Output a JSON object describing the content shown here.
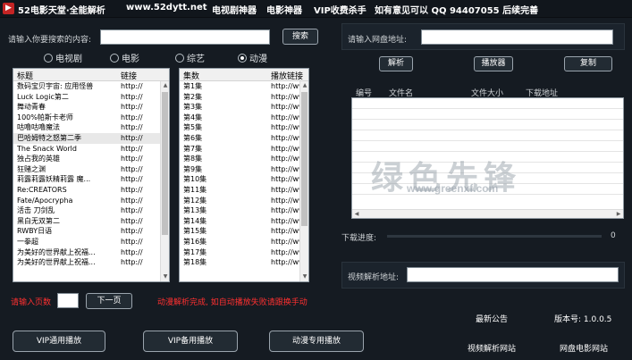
{
  "titlebar": {
    "app_title": "52电影天堂·全能解析",
    "site": "www.52dytt.net",
    "nav": [
      "电视剧神器",
      "电影神器",
      "VIP收费杀手",
      "如有意见可以  QQ 94407055  后续完善"
    ]
  },
  "search": {
    "label": "请输入你要搜索的内容:",
    "value": "",
    "button": "搜索"
  },
  "radios": [
    {
      "label": "电视剧",
      "checked": false
    },
    {
      "label": "电影",
      "checked": false
    },
    {
      "label": "综艺",
      "checked": false
    },
    {
      "label": "动漫",
      "checked": true
    }
  ],
  "title_list": {
    "headers": [
      "标题",
      "链接"
    ],
    "rows": [
      [
        "数码宝贝宇宙: 应用怪兽",
        "http://"
      ],
      [
        "Luck Logic第二",
        "http://"
      ],
      [
        "舞动青春",
        "http://"
      ],
      [
        "100%帕斯卡老师",
        "http://"
      ],
      [
        "咕噜咕噜魔法",
        "http://"
      ],
      [
        "巴哈姆特之怒第二季",
        "http://"
      ],
      [
        "The Snack World",
        "http://"
      ],
      [
        "独占我的英雄",
        "http://"
      ],
      [
        "狂赌之渊",
        "http://"
      ],
      [
        "莉露莉露妖精莉露 魔...",
        "http://"
      ],
      [
        "Re:CREATORS",
        "http://"
      ],
      [
        "Fate/Apocrypha",
        "http://"
      ],
      [
        "活击 刀剑乱",
        "http://"
      ],
      [
        "黑白无双第二",
        "http://"
      ],
      [
        "RWBY日语",
        "http://"
      ],
      [
        "一拳超",
        "http://"
      ],
      [
        "为美好的世界献上祝福...",
        "http://"
      ],
      [
        "为美好的世界献上祝福...",
        "http://"
      ]
    ]
  },
  "episode_list": {
    "headers": [
      "集数",
      "播放链接"
    ],
    "rows": [
      [
        "第1集",
        "http://www."
      ],
      [
        "第2集",
        "http://www."
      ],
      [
        "第3集",
        "http://www."
      ],
      [
        "第4集",
        "http://www."
      ],
      [
        "第5集",
        "http://www."
      ],
      [
        "第6集",
        "http://www."
      ],
      [
        "第7集",
        "http://www."
      ],
      [
        "第8集",
        "http://www."
      ],
      [
        "第9集",
        "http://www."
      ],
      [
        "第10集",
        "http://www."
      ],
      [
        "第11集",
        "http://www."
      ],
      [
        "第12集",
        "http://www."
      ],
      [
        "第13集",
        "http://www."
      ],
      [
        "第14集",
        "http://www."
      ],
      [
        "第15集",
        "http://www."
      ],
      [
        "第16集",
        "http://www."
      ],
      [
        "第17集",
        "http://www."
      ],
      [
        "第18集",
        "http://www."
      ]
    ]
  },
  "pager": {
    "label": "请输入页数",
    "value": "",
    "next_button": "下一页",
    "status": "动漫解析完成, 如自动播放失败请跟换手动"
  },
  "bottom_buttons": [
    "VIP通用播放",
    "VIP备用播放",
    "动漫专用播放"
  ],
  "netdisk": {
    "label": "请输入网盘地址:",
    "value": "",
    "buttons": [
      "解析",
      "播放器",
      "复制"
    ],
    "table_headers": [
      "编号",
      "文件名",
      "文件大小",
      "下载地址"
    ]
  },
  "progress": {
    "label": "下载进度:",
    "value_text": "0",
    "fraction": 0
  },
  "video_parse": {
    "label": "视频解析地址:",
    "value": ""
  },
  "footer": {
    "announcement": "最新公告",
    "version": "版本号: 1.0.0.5",
    "link_video": "视频解析网站",
    "link_net": "网盘电影网站"
  },
  "watermark": {
    "text": "绿色先锋",
    "sub": "www.greenxf.com"
  }
}
